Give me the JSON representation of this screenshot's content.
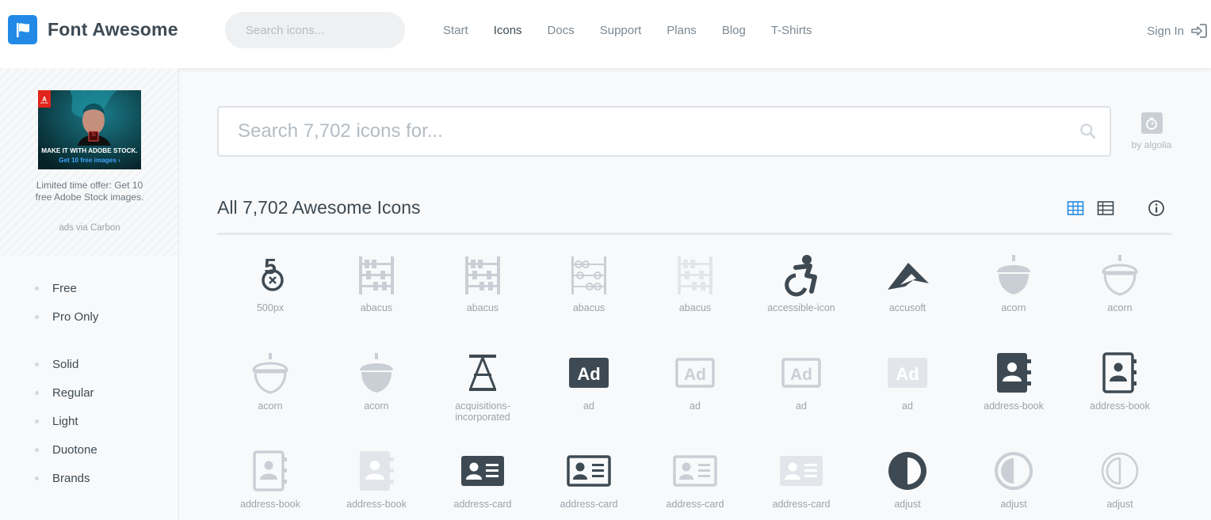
{
  "brand": {
    "name": "Font Awesome"
  },
  "top_search": {
    "placeholder": "Search icons..."
  },
  "nav": [
    {
      "label": "Start",
      "active": false
    },
    {
      "label": "Icons",
      "active": true
    },
    {
      "label": "Docs",
      "active": false
    },
    {
      "label": "Support",
      "active": false
    },
    {
      "label": "Plans",
      "active": false
    },
    {
      "label": "Blog",
      "active": false
    },
    {
      "label": "T-Shirts",
      "active": false
    }
  ],
  "signin": {
    "label": "Sign In"
  },
  "ad": {
    "headline": "MAKE IT WITH ADOBE STOCK.",
    "cta": "Get 10 free images ›",
    "brand_mark": "Adobe",
    "product_mark": "St",
    "text": "Limited time offer: Get 10 free Adobe Stock images.",
    "via": "ads via Carbon"
  },
  "filters": {
    "license": [
      "Free",
      "Pro Only"
    ],
    "style": [
      "Solid",
      "Regular",
      "Light",
      "Duotone",
      "Brands"
    ]
  },
  "search": {
    "placeholder": "Search 7,702 icons for..."
  },
  "algolia": {
    "label": "by algolia"
  },
  "heading": "All 7,702 Awesome Icons",
  "colors": {
    "accent": "#228ae6",
    "icon_dark": "#3e4a53",
    "icon_light": "#c9cfd5",
    "icon_duotone": "#e2e6ea"
  },
  "icons": [
    {
      "label": "500px",
      "glyph": "500px",
      "tone": "dark"
    },
    {
      "label": "abacus",
      "glyph": "abacus",
      "tone": "light"
    },
    {
      "label": "abacus",
      "glyph": "abacus",
      "tone": "light"
    },
    {
      "label": "abacus",
      "glyph": "abacus-outline",
      "tone": "light"
    },
    {
      "label": "abacus",
      "glyph": "abacus",
      "tone": "duo"
    },
    {
      "label": "accessible-icon",
      "glyph": "accessible",
      "tone": "dark"
    },
    {
      "label": "accusoft",
      "glyph": "accusoft",
      "tone": "dark"
    },
    {
      "label": "acorn",
      "glyph": "acorn-solid",
      "tone": "light"
    },
    {
      "label": "acorn",
      "glyph": "acorn-outline",
      "tone": "light"
    },
    {
      "label": "acorn",
      "glyph": "acorn-outline",
      "tone": "light"
    },
    {
      "label": "acorn",
      "glyph": "acorn-solid",
      "tone": "light"
    },
    {
      "label": "acquisitions-incorporated",
      "glyph": "acquisitions",
      "tone": "dark"
    },
    {
      "label": "ad",
      "glyph": "ad-solid",
      "tone": "dark"
    },
    {
      "label": "ad",
      "glyph": "ad-outline",
      "tone": "light"
    },
    {
      "label": "ad",
      "glyph": "ad-outline",
      "tone": "light"
    },
    {
      "label": "ad",
      "glyph": "ad-solid",
      "tone": "duo"
    },
    {
      "label": "address-book",
      "glyph": "address-book-solid",
      "tone": "dark"
    },
    {
      "label": "address-book",
      "glyph": "address-book-outline",
      "tone": "dark"
    },
    {
      "label": "address-book",
      "glyph": "address-book-outline",
      "tone": "light"
    },
    {
      "label": "address-book",
      "glyph": "address-book-solid",
      "tone": "duo"
    },
    {
      "label": "address-card",
      "glyph": "address-card-solid",
      "tone": "dark"
    },
    {
      "label": "address-card",
      "glyph": "address-card-outline",
      "tone": "dark"
    },
    {
      "label": "address-card",
      "glyph": "address-card-outline",
      "tone": "light"
    },
    {
      "label": "address-card",
      "glyph": "address-card-solid",
      "tone": "duo"
    },
    {
      "label": "adjust",
      "glyph": "adjust-solid",
      "tone": "dark"
    },
    {
      "label": "adjust",
      "glyph": "adjust-outline",
      "tone": "light"
    },
    {
      "label": "adjust",
      "glyph": "adjust-thin",
      "tone": "light"
    }
  ]
}
